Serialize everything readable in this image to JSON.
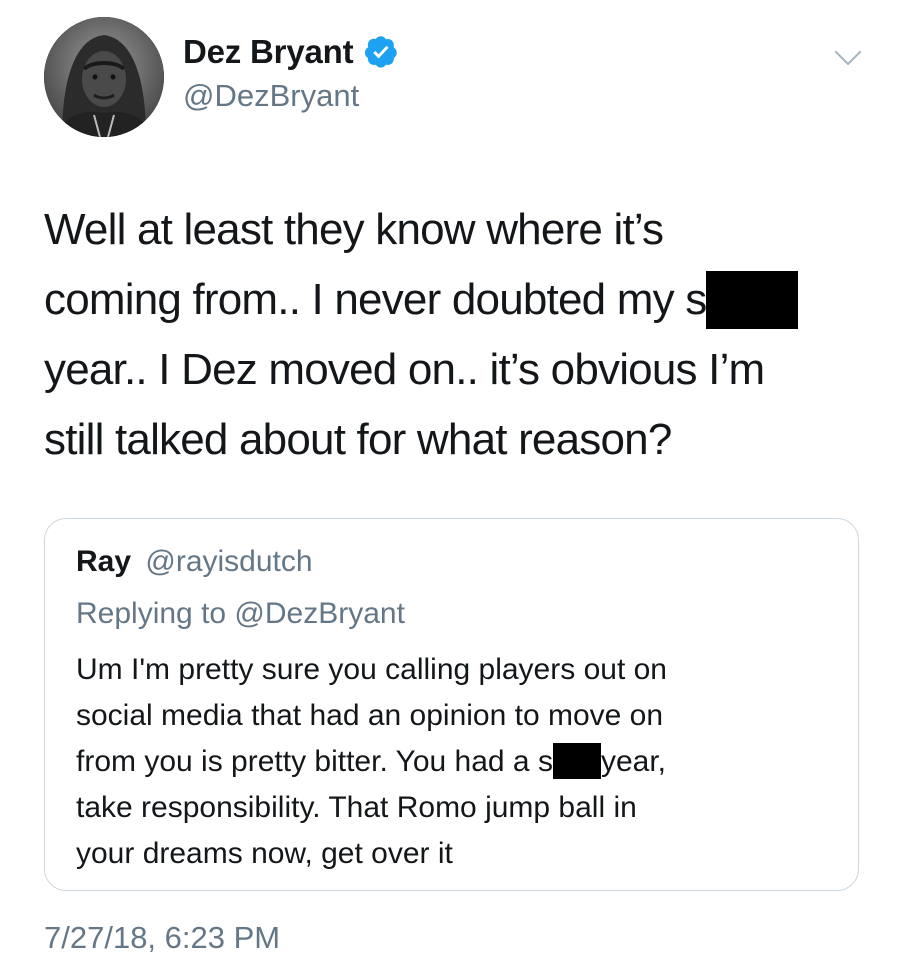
{
  "tweet": {
    "author": {
      "display_name": "Dez Bryant",
      "handle": "@DezBryant",
      "verified": true,
      "avatar_icon": "profile-photo-hooded-man"
    },
    "menu_icon": "chevron-down-icon",
    "text_lines": [
      "Well at least they know where it’s",
      "coming from.. I never doubted my s",
      "year.. I Dez moved on.. it’s obvious I’m",
      "still talked about for what reason?"
    ],
    "timestamp": "7/27/18, 6:23 PM"
  },
  "quoted_tweet": {
    "display_name": "Ray",
    "handle": "@rayisdutch",
    "replying_to": "Replying to @DezBryant",
    "text_lines": [
      "Um I'm pretty sure you calling players out on",
      "social media that had an opinion to move on",
      "from you is pretty bitter. You had a s",
      "year,",
      "take responsibility. That Romo jump ball in",
      "your dreams now, get over it"
    ]
  },
  "colors": {
    "text": "#14171a",
    "secondary": "#657786",
    "verified_blue": "#1da1f2",
    "border": "#ccd6dd"
  }
}
